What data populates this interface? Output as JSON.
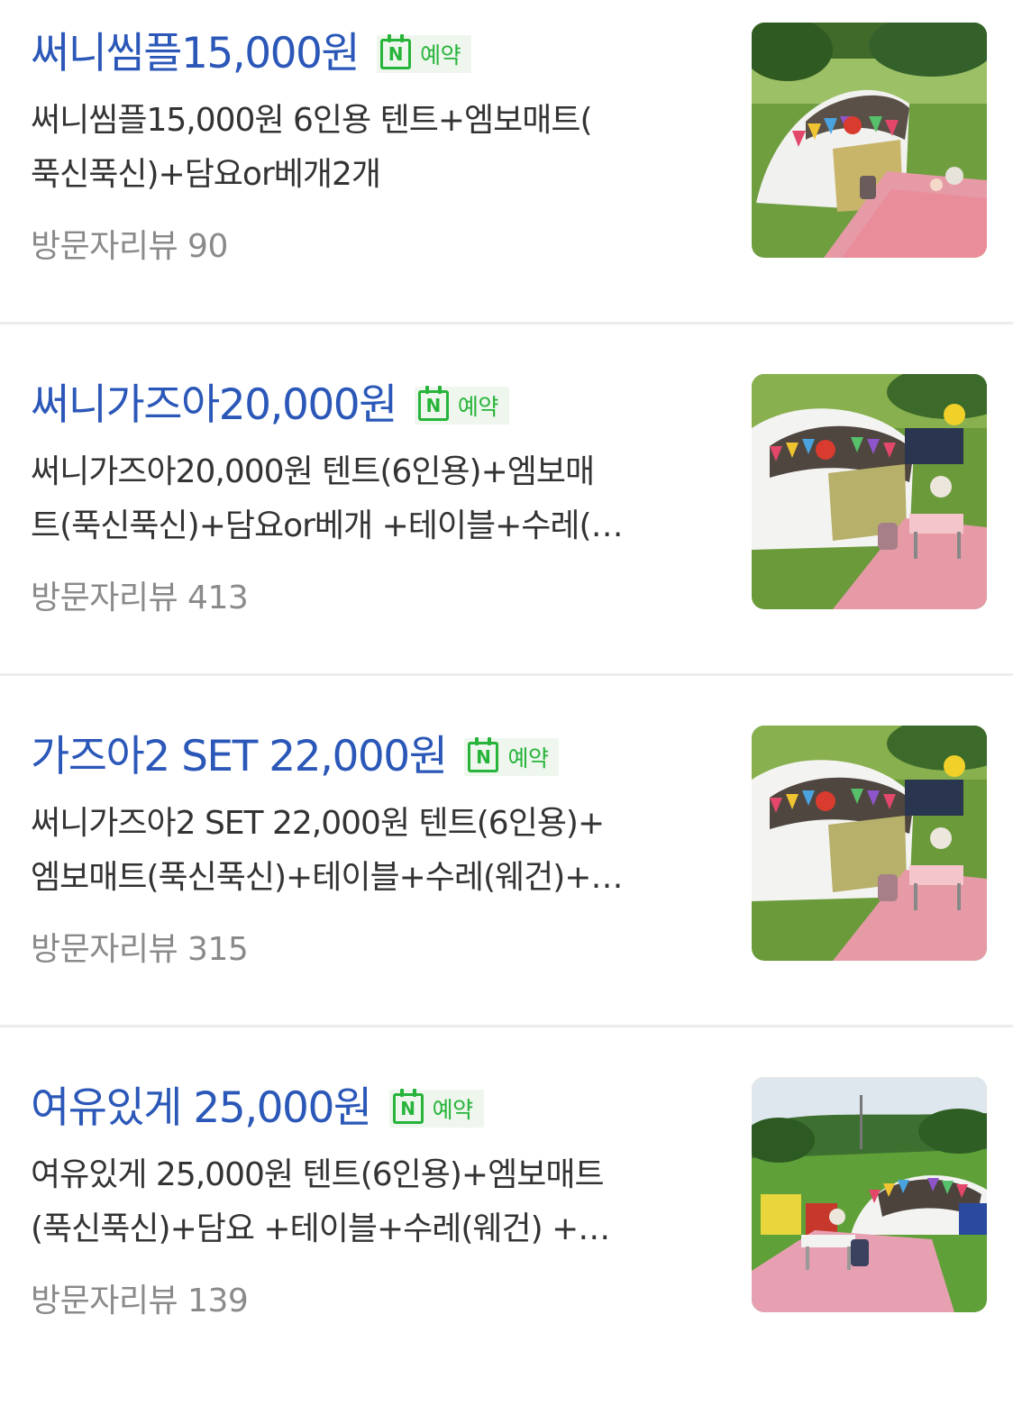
{
  "items": [
    {
      "title": "써니씸플15,000원",
      "badge": "예약",
      "badge_icon": "naver-booking-icon",
      "description": "써니씸플15,000원 6인용 텐트+엠보매트(\n푹신푹신)+담요or베개2개",
      "reviews": "방문자리뷰 90",
      "thumb_desc": "tent-on-grass-photo"
    },
    {
      "title": "써니가즈아20,000원",
      "badge": "예약",
      "badge_icon": "naver-booking-icon",
      "description": "써니가즈아20,000원 텐트(6인용)+엠보매\n트(푹신푹신)+담요or베개 +테이블+수레(…",
      "reviews": "방문자리뷰 413",
      "thumb_desc": "tent-with-table-photo"
    },
    {
      "title": "가즈아2 SET 22,000원",
      "badge": "예약",
      "badge_icon": "naver-booking-icon",
      "description": "써니가즈아2 SET 22,000원 텐트(6인용)+\n엠보매트(푹신푹신)+테이블+수레(웨건)+…",
      "reviews": "방문자리뷰 315",
      "thumb_desc": "tent-with-table-photo"
    },
    {
      "title": "여유있게 25,000원",
      "badge": "예약",
      "badge_icon": "naver-booking-icon",
      "description": "여유있게 25,000원 텐트(6인용)+엠보매트\n(푹신푹신)+담요 +테이블+수레(웨건) +…",
      "reviews": "방문자리뷰 139",
      "thumb_desc": "campsite-with-chairs-photo"
    }
  ],
  "colors": {
    "title": "#2b58b8",
    "badge_green": "#27b43a",
    "badge_bg": "#eef6ed",
    "text": "#333333",
    "muted": "#8a8a8a",
    "divider": "#ececec"
  }
}
